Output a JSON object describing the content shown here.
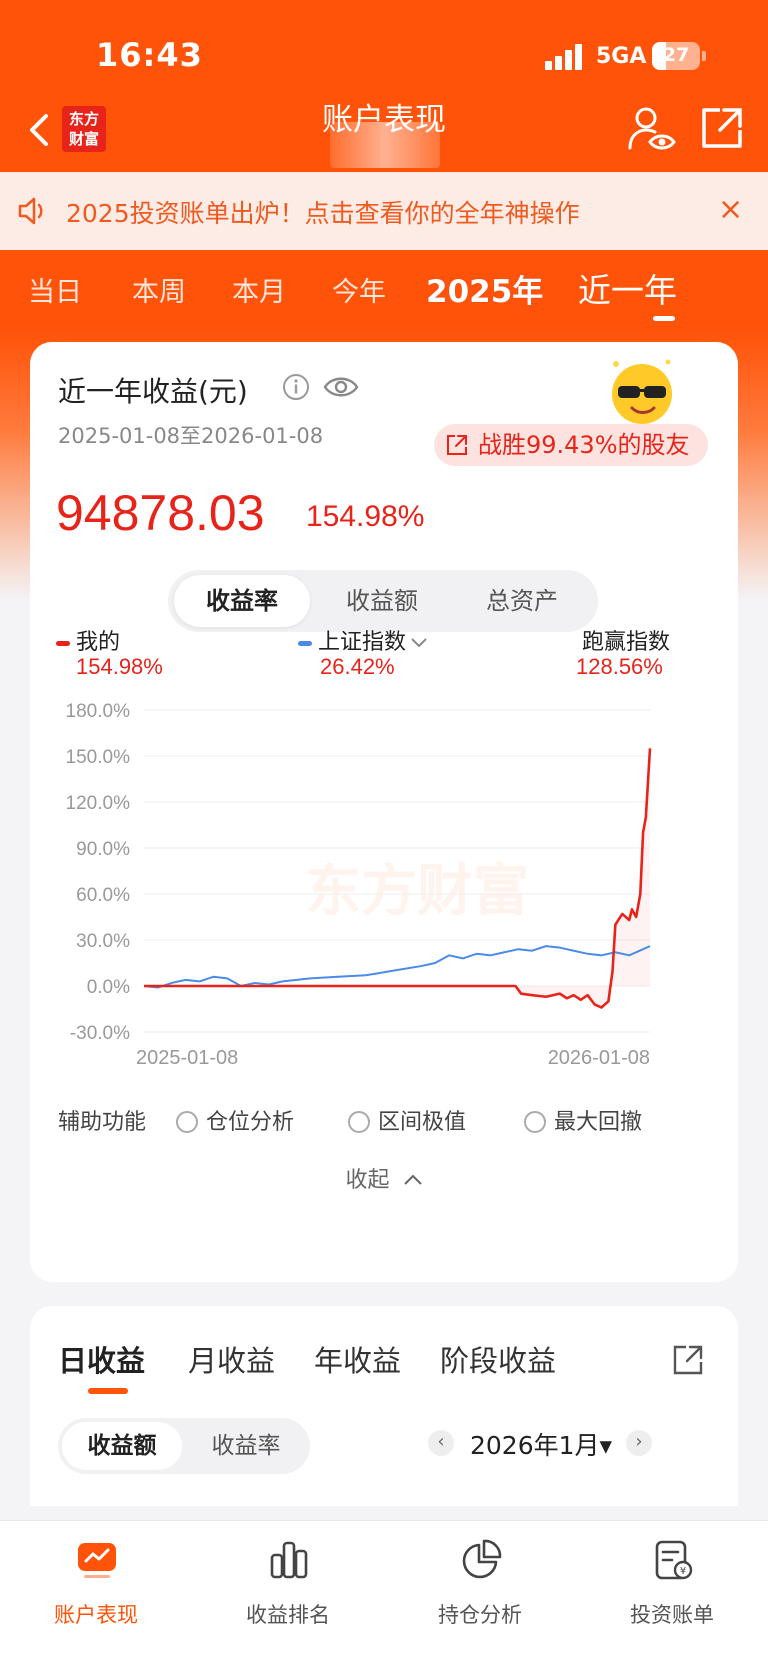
{
  "status_bar": {
    "time": "16:43",
    "network": "5GA",
    "battery": "27"
  },
  "nav": {
    "title": "账户表现",
    "logo_text": "东方财富"
  },
  "banner": {
    "text": "2025投资账单出炉！点击查看你的全年神操作",
    "close": "×"
  },
  "periods": [
    "当日",
    "本周",
    "本月",
    "今年",
    "2025年",
    "近一年"
  ],
  "active_period": "近一年",
  "card": {
    "title": "近一年收益(元)",
    "date_range": "2025-01-08至2026-01-08",
    "beat_text": "战胜99.43%的股友",
    "profit": "94878.03",
    "profit_pct": "154.98%",
    "metric_tabs": [
      "收益率",
      "收益额",
      "总资产"
    ],
    "legend": [
      {
        "name": "我的",
        "value": "154.98%"
      },
      {
        "name": "上证指数",
        "value": "26.42%"
      },
      {
        "name": "跑赢指数",
        "value": "128.56%"
      }
    ],
    "aux_label": "辅助功能",
    "aux_options": [
      "仓位分析",
      "区间极值",
      "最大回撤"
    ],
    "collapse_label": "收起"
  },
  "chart_data": {
    "type": "line",
    "watermark": "东方财富",
    "y_ticks": [
      "180.0%",
      "150.0%",
      "120.0%",
      "90.0%",
      "60.0%",
      "30.0%",
      "0.0%",
      "-30.0%"
    ],
    "x_labels": [
      "2025-01-08",
      "2026-01-08"
    ],
    "ylim": [
      -30,
      180
    ],
    "grid": true,
    "colors": {
      "mine": "#e8231a",
      "index": "#4a8ae8"
    },
    "series": [
      {
        "name": "我的",
        "x": [
          0,
          30,
          60,
          90,
          120,
          150,
          180,
          210,
          240,
          268,
          272,
          280,
          290,
          300,
          305,
          310,
          315,
          320,
          325,
          330,
          335,
          338,
          340,
          345,
          350,
          352,
          355,
          358,
          360,
          362,
          364,
          365
        ],
        "values": [
          0,
          0,
          0,
          0,
          0,
          0,
          0,
          0,
          0,
          0,
          -5,
          -6,
          -7,
          -5,
          -8,
          -6,
          -9,
          -6,
          -12,
          -14,
          -10,
          10,
          40,
          47,
          43,
          50,
          45,
          60,
          100,
          110,
          140,
          155
        ]
      },
      {
        "name": "上证指数",
        "x": [
          0,
          10,
          20,
          30,
          40,
          50,
          60,
          70,
          80,
          90,
          100,
          120,
          140,
          160,
          180,
          200,
          210,
          220,
          230,
          240,
          250,
          260,
          270,
          280,
          290,
          300,
          310,
          320,
          330,
          340,
          350,
          360,
          365
        ],
        "values": [
          0,
          -1,
          2,
          4,
          3,
          6,
          5,
          0,
          2,
          1,
          3,
          5,
          6,
          7,
          10,
          13,
          15,
          20,
          18,
          21,
          20,
          22,
          24,
          23,
          26,
          25,
          23,
          21,
          20,
          22,
          20,
          24,
          26
        ]
      }
    ]
  },
  "returns_card": {
    "tabs": [
      "日收益",
      "月收益",
      "年收益",
      "阶段收益"
    ],
    "sub_tabs": [
      "收益额",
      "收益率"
    ],
    "month": "2026年1月▾",
    "prev": "‹",
    "next": "›"
  },
  "bottom_nav": [
    "账户表现",
    "收益排名",
    "持仓分析",
    "投资账单"
  ]
}
